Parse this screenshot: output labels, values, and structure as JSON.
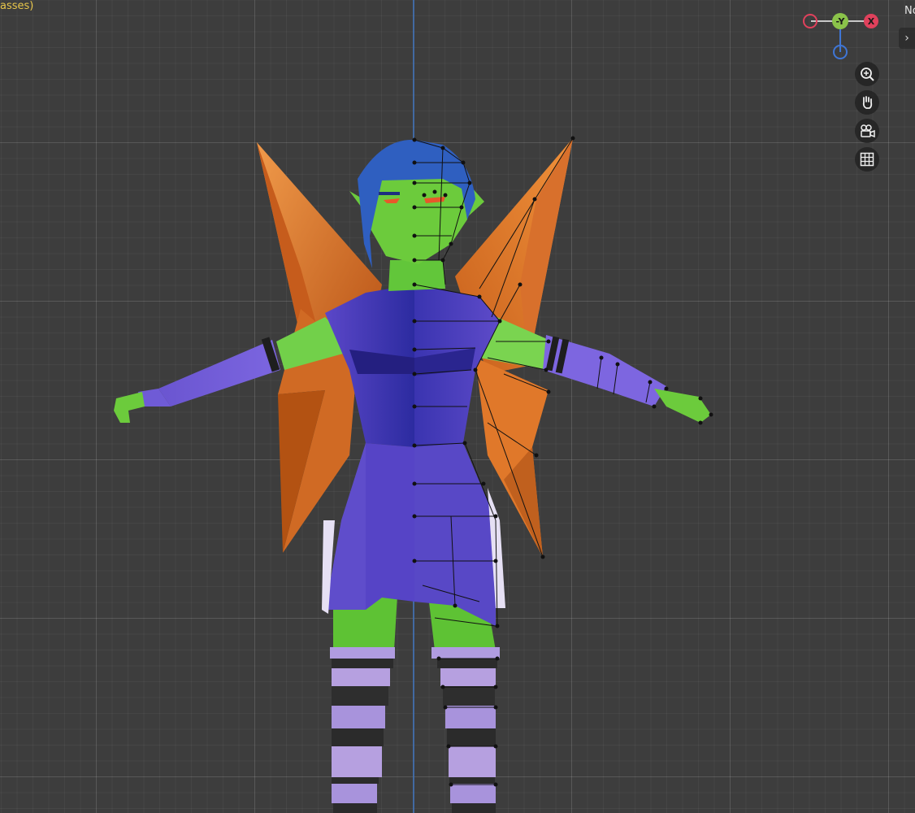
{
  "viewport": {
    "mode_label": "asses)",
    "grid_color": "#3d3d3d"
  },
  "gizmo": {
    "y_label": "-Y",
    "x_label": "X",
    "y_color": "#8bc34a",
    "x_color": "#e0415c",
    "z_color": "#3f76d6",
    "neg_x_color": "#e0415c"
  },
  "nav": {
    "zoom_icon": "zoom-in-icon",
    "pan_icon": "hand-pan-icon",
    "camera_icon": "camera-view-icon",
    "ortho_icon": "grid-ortho-icon"
  },
  "sidebar": {
    "panel_label": "No",
    "toggle_glyph": "›"
  },
  "model": {
    "skin_color": "#6ccb3c",
    "dress_color": "#5a3fc2",
    "hair_color": "#2f5fc0",
    "wing_color": "#e37a2a",
    "stocking_light": "#b6a0e0",
    "stocking_dark": "#2b2b2b"
  }
}
